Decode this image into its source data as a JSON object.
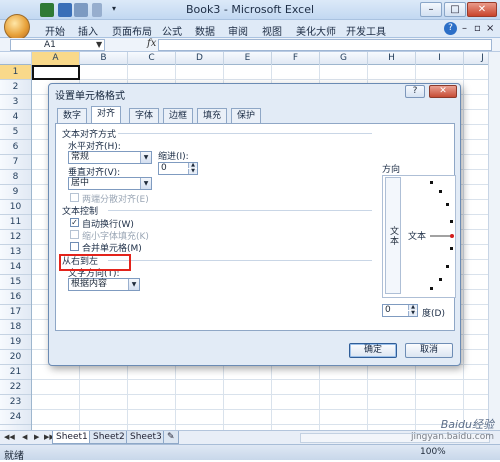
{
  "window": {
    "title": "Book3 - Microsoft Excel",
    "min_label": "–",
    "max_label": "□",
    "close_label": "✕"
  },
  "ribbon": {
    "tabs": [
      "开始",
      "插入",
      "页面布局",
      "公式",
      "数据",
      "审阅",
      "视图",
      "美化大师",
      "开发工具"
    ],
    "help": "?"
  },
  "formula_bar": {
    "name_box": "A1",
    "fx": "fx",
    "formula": ""
  },
  "grid": {
    "columns": [
      "A",
      "B",
      "C",
      "D",
      "E",
      "F",
      "G",
      "H",
      "I",
      "J"
    ],
    "rows": [
      "1",
      "2",
      "3",
      "4",
      "5",
      "6",
      "7",
      "8",
      "9",
      "10",
      "11",
      "12",
      "13",
      "14",
      "15",
      "16",
      "17",
      "18",
      "19",
      "20",
      "21",
      "22",
      "23",
      "24"
    ]
  },
  "sheets": {
    "tabs": [
      "Sheet1",
      "Sheet2",
      "Sheet3"
    ],
    "active": "Sheet1"
  },
  "status": {
    "text": "就绪",
    "zoom": "100%"
  },
  "dialog": {
    "title": "设置单元格格式",
    "help": "?",
    "close": "✕",
    "tabs": [
      "数字",
      "对齐",
      "字体",
      "边框",
      "填充",
      "保护"
    ],
    "active_tab": "对齐",
    "text_alignment": {
      "section": "文本对齐方式",
      "horizontal_label": "水平对齐(H):",
      "horizontal_value": "常规",
      "vertical_label": "垂直对齐(V):",
      "vertical_value": "居中",
      "indent_label": "缩进(I):",
      "indent_value": "0",
      "justify_distributed": "两端分散对齐(E)"
    },
    "text_control": {
      "section": "文本控制",
      "wrap_text": "自动换行(W)",
      "wrap_checked": true,
      "shrink_to_fit": "缩小字体填充(K)",
      "merge_cells": "合并单元格(M)"
    },
    "rtl": {
      "section": "从右到左",
      "direction_label": "文字方向(T):",
      "direction_value": "根据内容"
    },
    "orientation": {
      "section": "方向",
      "vertical_text": "文本",
      "dial_text": "文本",
      "degrees_value": "0",
      "degrees_label": "度(D)"
    },
    "ok": "确定",
    "cancel": "取消"
  },
  "watermark": {
    "line1": "Baidu经验",
    "line2": "jingyan.baidu.com"
  }
}
